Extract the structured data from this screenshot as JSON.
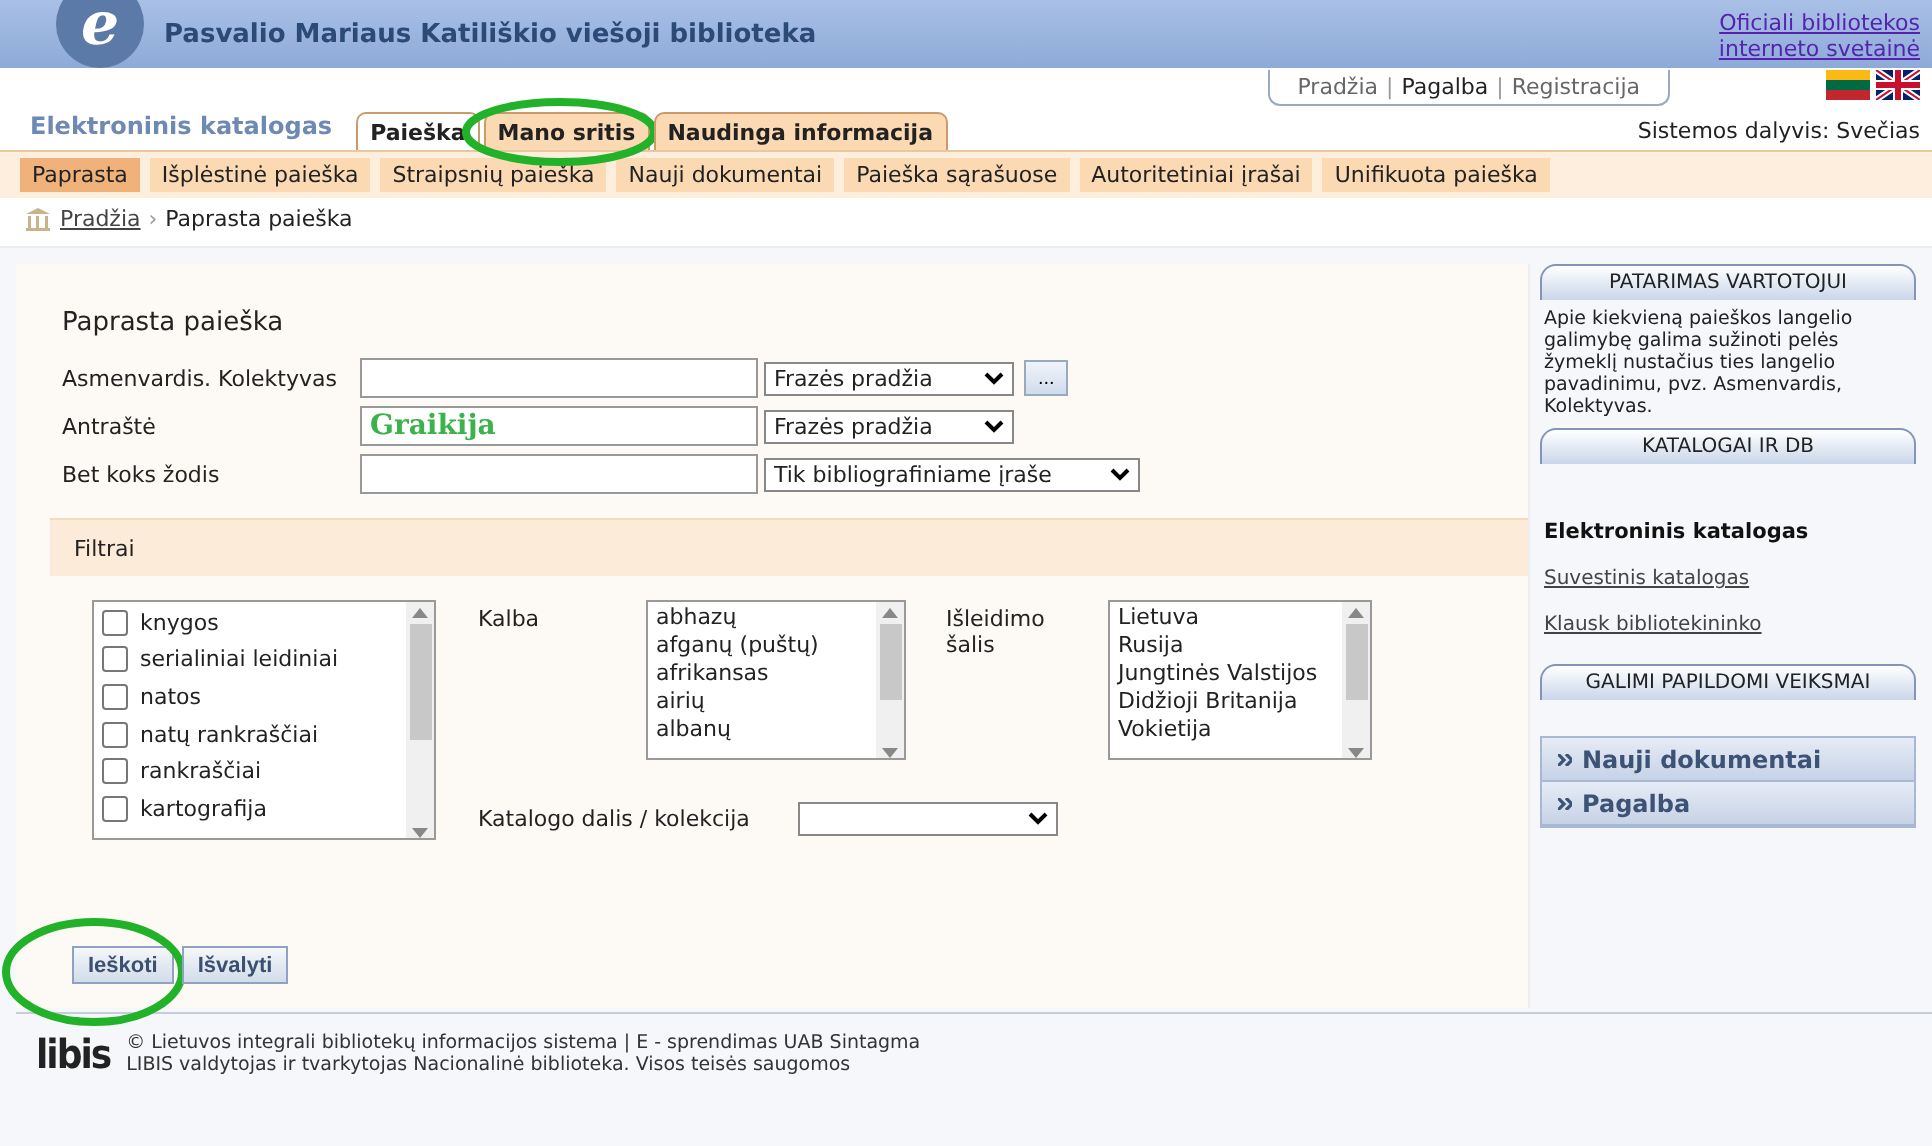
{
  "header": {
    "logo_letter": "e",
    "title": "Pasvalio Mariaus Katiliškio viešoji biblioteka",
    "official_link": [
      "Oficiali bibliotekos",
      "interneto svetainė"
    ]
  },
  "top_links_separator": "|",
  "top_links": [
    {
      "label": "Pradžia",
      "selected": false
    },
    {
      "label": "Pagalba",
      "selected": true
    },
    {
      "label": "Registracija",
      "selected": false
    }
  ],
  "catalog_title": "Elektroninis katalogas",
  "tabs": [
    {
      "label": "Paieška",
      "selected": true,
      "circled": false
    },
    {
      "label": "Mano sritis",
      "selected": false,
      "circled": true
    },
    {
      "label": "Naudinga informacija",
      "selected": false,
      "circled": false
    }
  ],
  "user_status": "Sistemos dalyvis: Svečias",
  "subtabs": [
    {
      "label": "Paprasta",
      "selected": true
    },
    {
      "label": "Išplėstinė paieška",
      "selected": false
    },
    {
      "label": "Straipsnių paieška",
      "selected": false
    },
    {
      "label": "Nauji dokumentai",
      "selected": false
    },
    {
      "label": "Paieška sąrašuose",
      "selected": false
    },
    {
      "label": "Autoritetiniai įrašai",
      "selected": false
    },
    {
      "label": "Unifikuota paieška",
      "selected": false
    }
  ],
  "breadcrumb": {
    "link": "Pradžia",
    "separator": "›",
    "current": "Paprasta paieška"
  },
  "form": {
    "heading": "Paprasta paieška",
    "fields": [
      {
        "label": "Asmenvardis. Kolektyvas",
        "mode": "Frazės pradžia",
        "browse_label": "..."
      },
      {
        "label": "Antraštė",
        "value": "Graikija",
        "mode": "Frazės pradžia"
      },
      {
        "label": "Bet koks žodis",
        "mode": "Tik bibliografiniame įraše"
      }
    ],
    "filters_title": "Filtrai",
    "doc_types": [
      {
        "label": "knygos",
        "checked": false
      },
      {
        "label": "serialiniai leidiniai",
        "checked": false
      },
      {
        "label": "natos",
        "checked": false
      },
      {
        "label": "natų rankraščiai",
        "checked": false
      },
      {
        "label": "rankraščiai",
        "checked": false
      },
      {
        "label": "kartografija",
        "checked": false
      }
    ],
    "language_label": "Kalba",
    "languages": [
      "abhazų",
      "afganų (puštų)",
      "afrikansas",
      "airių",
      "albanų"
    ],
    "country_label": "Išleidimo šalis",
    "countries": [
      "Lietuva",
      "Rusija",
      "Jungtinės Valstijos",
      "Didžioji Britanija",
      "Vokietija"
    ],
    "collection_label": "Katalogo dalis / kolekcija",
    "buttons": [
      {
        "label": "Ieškoti",
        "circled": true
      },
      {
        "label": "Išvalyti",
        "circled": false
      }
    ]
  },
  "sidebar": {
    "tip_title": "PATARIMAS VARTOTOJUI",
    "tip_text": "Apie kiekvieną paieškos langelio galimybę galima sužinoti pelės žymeklį nustačius ties langelio pavadinimu, pvz. Asmenvardis, Kolektyvas.",
    "catalogs_title": "KATALOGAI IR DB",
    "catalogs": [
      {
        "label": "Elektroninis katalogas",
        "selected": true
      },
      {
        "label": "Suvestinis katalogas",
        "selected": false
      },
      {
        "label": "Klausk bibliotekininko",
        "selected": false
      }
    ],
    "actions_title": "GALIMI PAPILDOMI VEIKSMAI",
    "actions": [
      "Nauji dokumentai",
      "Pagalba"
    ]
  },
  "footer": {
    "logo": "libis",
    "lines": [
      "© Lietuvos integrali bibliotekų informacijos sistema | E - sprendimas UAB Sintagma",
      "LIBIS valdytojas ir tvarkytojas Nacionalinė biblioteka. Visos teisės saugomos"
    ]
  }
}
